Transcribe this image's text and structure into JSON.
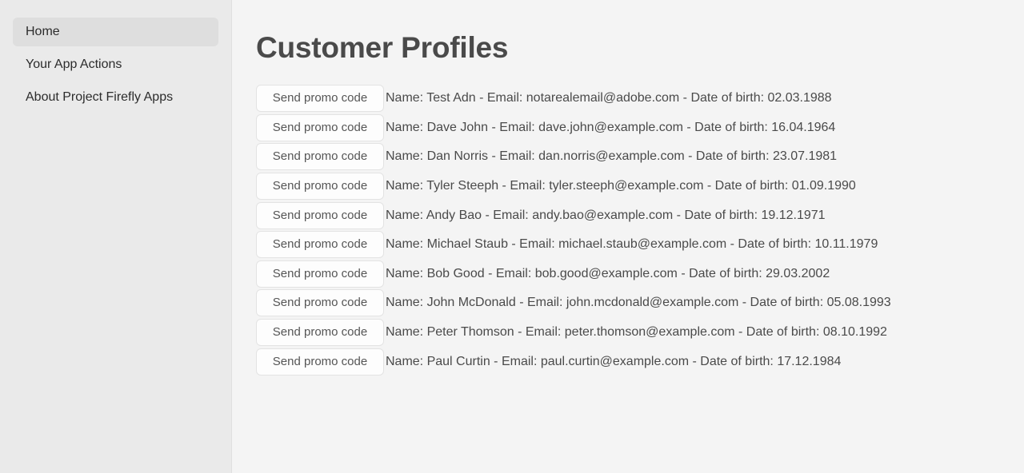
{
  "sidebar": {
    "items": [
      {
        "label": "Home",
        "selected": true
      },
      {
        "label": "Your App Actions",
        "selected": false
      },
      {
        "label": "About Project Firefly Apps",
        "selected": false
      }
    ]
  },
  "main": {
    "title": "Customer Profiles",
    "button_label": "Send promo code",
    "profiles": [
      {
        "text": "Name: Test Adn - Email: notarealemail@adobe.com - Date of birth: 02.03.1988",
        "name": "Test Adn",
        "email": "notarealemail@adobe.com",
        "dob": "02.03.1988"
      },
      {
        "text": "Name: Dave John - Email: dave.john@example.com - Date of birth: 16.04.1964",
        "name": "Dave John",
        "email": "dave.john@example.com",
        "dob": "16.04.1964"
      },
      {
        "text": "Name: Dan Norris - Email: dan.norris@example.com - Date of birth: 23.07.1981",
        "name": "Dan Norris",
        "email": "dan.norris@example.com",
        "dob": "23.07.1981"
      },
      {
        "text": "Name: Tyler Steeph - Email: tyler.steeph@example.com - Date of birth: 01.09.1990",
        "name": "Tyler Steeph",
        "email": "tyler.steeph@example.com",
        "dob": "01.09.1990"
      },
      {
        "text": "Name: Andy Bao - Email: andy.bao@example.com - Date of birth: 19.12.1971",
        "name": "Andy Bao",
        "email": "andy.bao@example.com",
        "dob": "19.12.1971"
      },
      {
        "text": "Name: Michael Staub - Email: michael.staub@example.com - Date of birth: 10.11.1979",
        "name": "Michael Staub",
        "email": "michael.staub@example.com",
        "dob": "10.11.1979"
      },
      {
        "text": "Name: Bob Good - Email: bob.good@example.com - Date of birth: 29.03.2002",
        "name": "Bob Good",
        "email": "bob.good@example.com",
        "dob": "29.03.2002"
      },
      {
        "text": "Name: John McDonald - Email: john.mcdonald@example.com - Date of birth: 05.08.1993",
        "name": "John McDonald",
        "email": "john.mcdonald@example.com",
        "dob": "05.08.1993"
      },
      {
        "text": "Name: Peter Thomson - Email: peter.thomson@example.com - Date of birth: 08.10.1992",
        "name": "Peter Thomson",
        "email": "peter.thomson@example.com",
        "dob": "08.10.1992"
      },
      {
        "text": "Name: Paul Curtin - Email: paul.curtin@example.com - Date of birth: 17.12.1984",
        "name": "Paul Curtin",
        "email": "paul.curtin@example.com",
        "dob": "17.12.1984"
      }
    ]
  },
  "colors": {
    "sidebar_bg": "#eaeaea",
    "sidebar_selected_bg": "#dedede",
    "main_bg": "#f4f4f4",
    "text": "#4a4a4a",
    "button_bg": "#fdfdfd",
    "button_border": "#e3e3e3"
  }
}
